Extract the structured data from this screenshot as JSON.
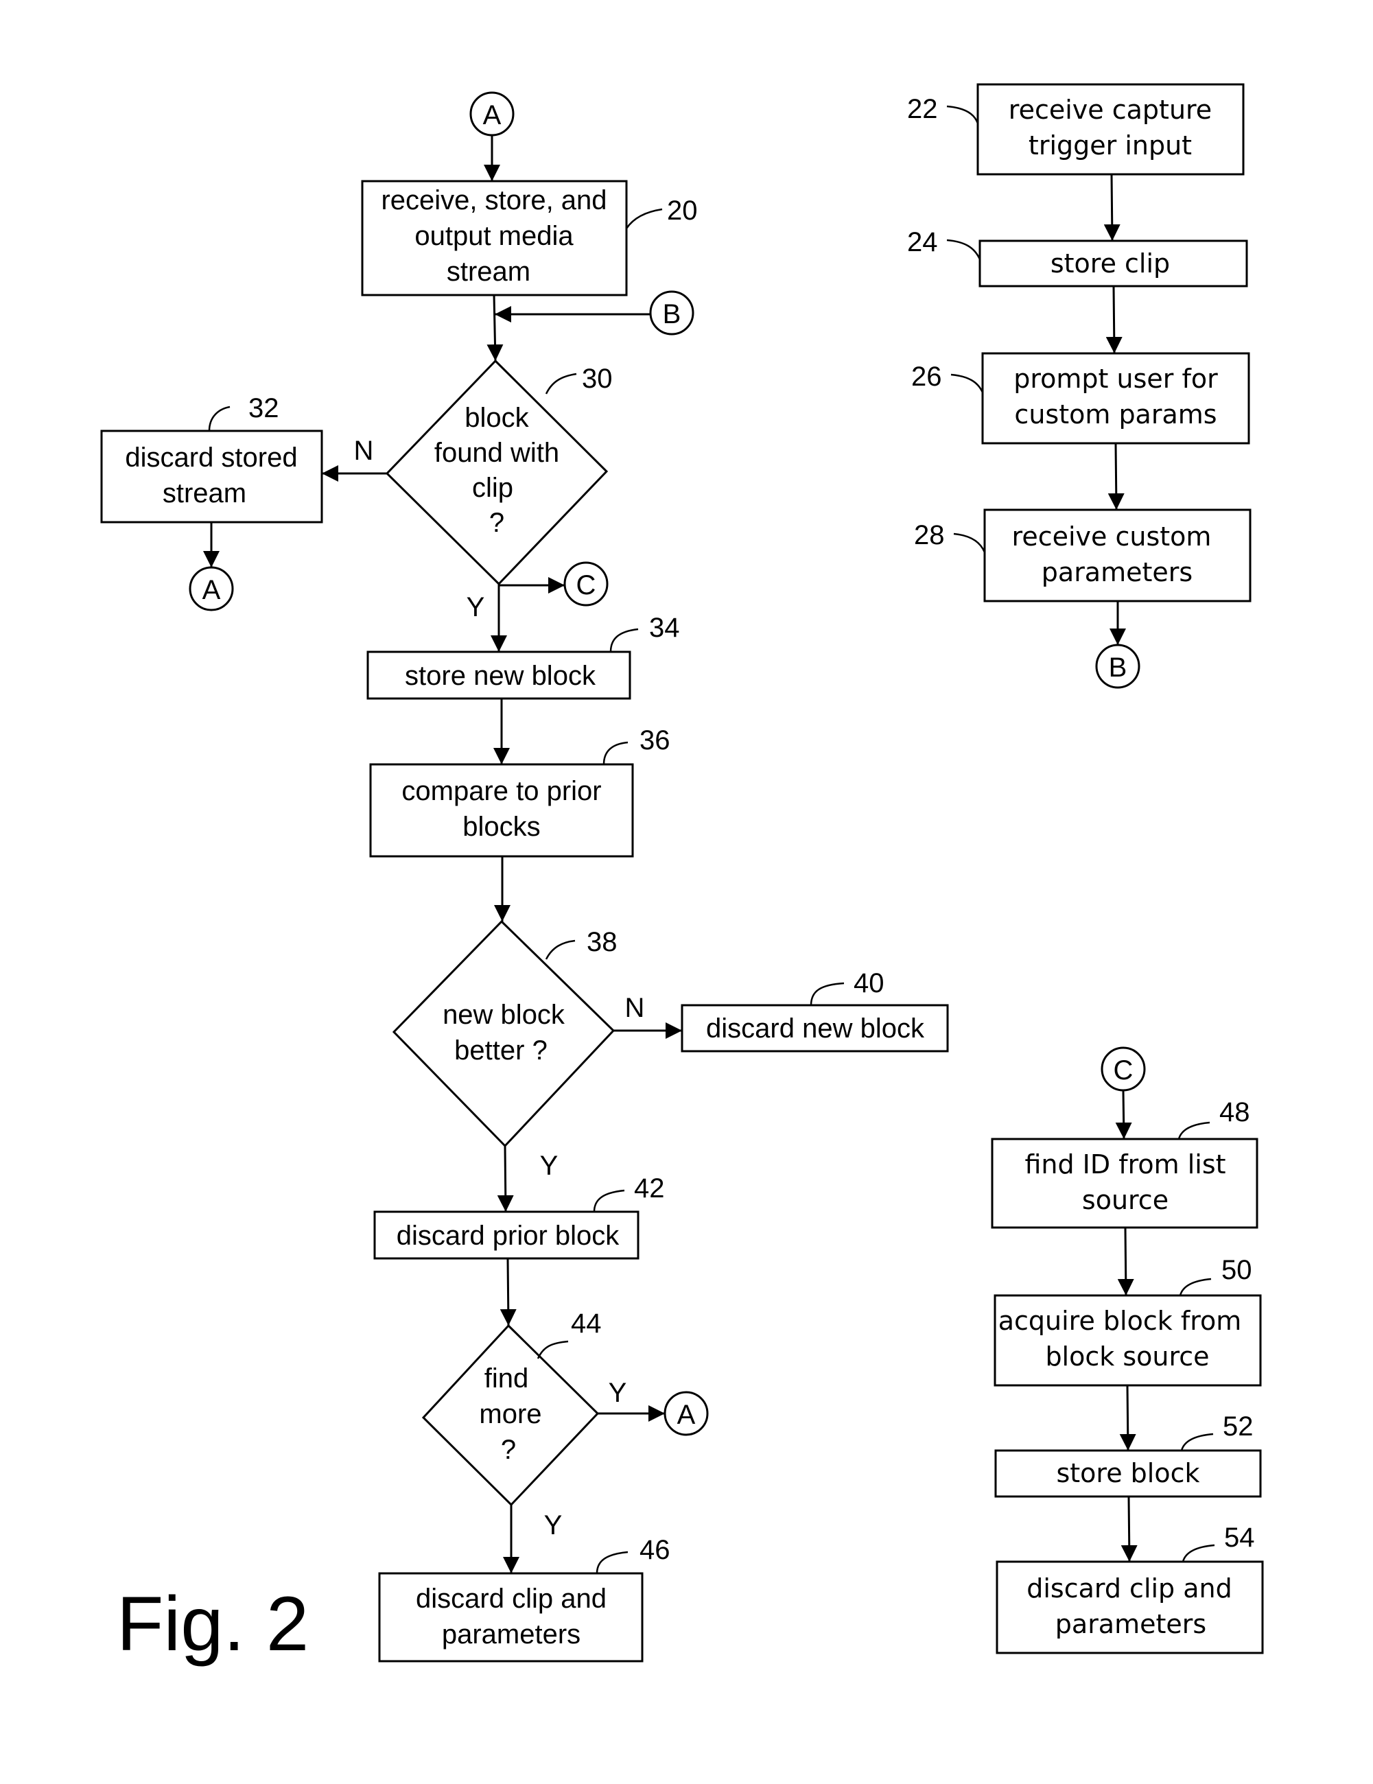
{
  "figure_label": "Fig. 2",
  "connectors": {
    "a_top": "A",
    "b_entry": "B",
    "a_after_32": "A",
    "c_from_30": "C",
    "a_from_44": "A",
    "b_exit": "B",
    "c_entry": "C"
  },
  "branch_labels": {
    "d30_no": "N",
    "d30_yes": "Y",
    "d38_no": "N",
    "d38_yes": "Y",
    "d44_right": "Y",
    "d44_down": "Y"
  },
  "main_flow": {
    "s20": {
      "ref": "20",
      "lines": [
        "receive, store, and",
        "output media",
        "stream"
      ]
    },
    "s30": {
      "ref": "30",
      "lines": [
        "block",
        "found with",
        "clip",
        "?"
      ]
    },
    "s32": {
      "ref": "32",
      "lines": [
        "discard stored",
        "stream"
      ]
    },
    "s34": {
      "ref": "34",
      "lines": [
        "store new block"
      ]
    },
    "s36": {
      "ref": "36",
      "lines": [
        "compare to prior",
        "blocks"
      ]
    },
    "s38": {
      "ref": "38",
      "lines": [
        "new block",
        "better ?"
      ]
    },
    "s40": {
      "ref": "40",
      "lines": [
        "discard new block"
      ]
    },
    "s42": {
      "ref": "42",
      "lines": [
        "discard prior block"
      ]
    },
    "s44": {
      "ref": "44",
      "lines": [
        "find",
        "more",
        "?"
      ]
    },
    "s46": {
      "ref": "46",
      "lines": [
        "discard clip and",
        "parameters"
      ]
    }
  },
  "capture_flow": {
    "s22": {
      "ref": "22",
      "lines": [
        "receive capture",
        "trigger input"
      ]
    },
    "s24": {
      "ref": "24",
      "lines": [
        "store clip"
      ]
    },
    "s26": {
      "ref": "26",
      "lines": [
        "prompt user for",
        "custom params"
      ]
    },
    "s28": {
      "ref": "28",
      "lines": [
        "receive custom",
        "parameters"
      ]
    }
  },
  "acquire_flow": {
    "s48": {
      "ref": "48",
      "lines": [
        "find ID from list",
        "source"
      ]
    },
    "s50": {
      "ref": "50",
      "lines": [
        "acquire block from",
        "block source"
      ]
    },
    "s52": {
      "ref": "52",
      "lines": [
        "store block"
      ]
    },
    "s54": {
      "ref": "54",
      "lines": [
        "discard clip and",
        "parameters"
      ]
    }
  }
}
